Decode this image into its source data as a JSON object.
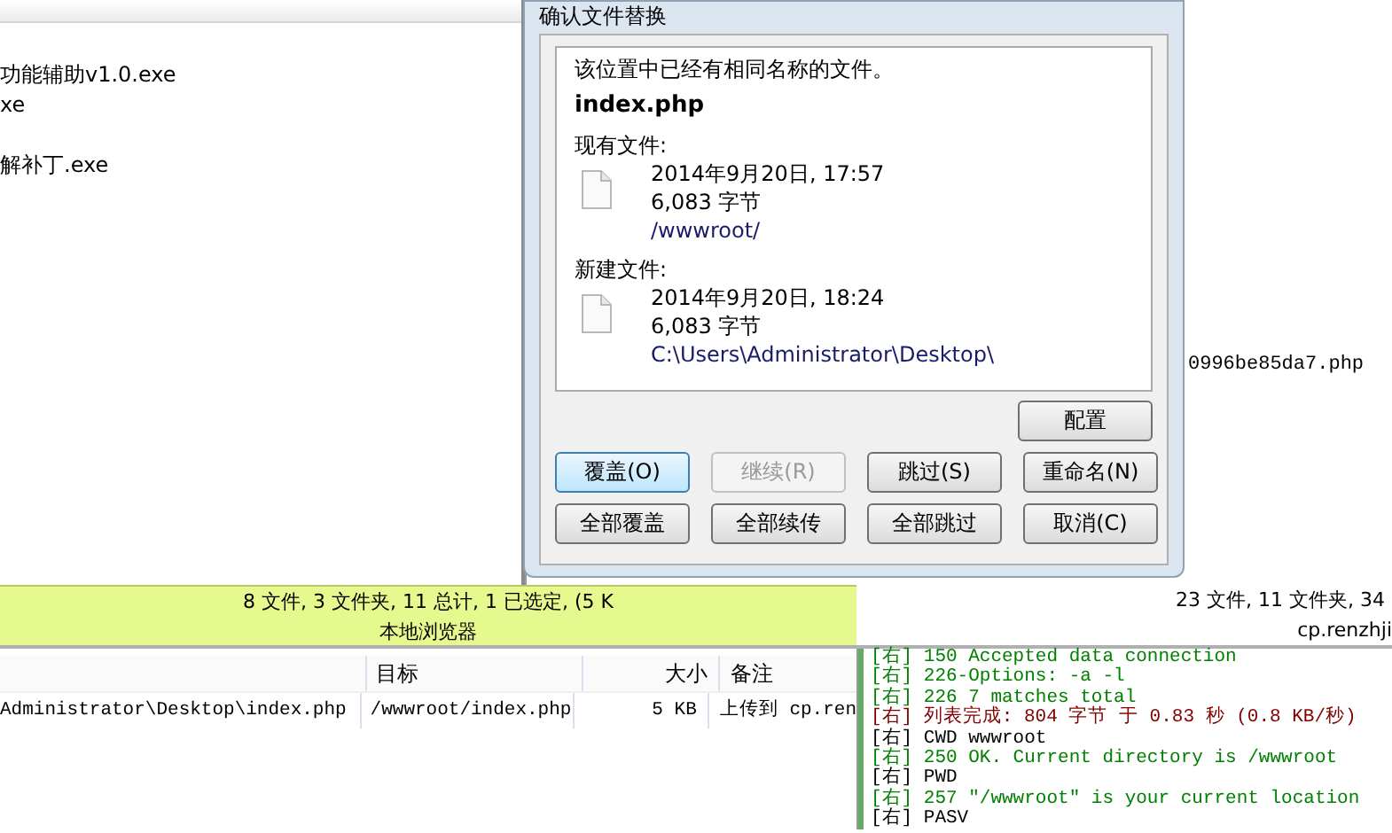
{
  "local_pane": {
    "files": [
      "功能辅助v1.0.exe",
      "xe",
      "解补丁.exe"
    ]
  },
  "remote_pane": {
    "files": [
      "0996be85da7.php"
    ]
  },
  "dialog": {
    "title": "确认文件替换",
    "message": "该位置中已经有相同名称的文件。",
    "filename": "index.php",
    "existing": {
      "label": "现有文件:",
      "date": "2014年9月20日, 17:57",
      "size": "6,083 字节",
      "path": "/wwwroot/"
    },
    "new": {
      "label": "新建文件:",
      "date": "2014年9月20日, 18:24",
      "size": "6,083 字节",
      "path": "C:\\Users\\Administrator\\Desktop\\"
    },
    "config_button": "配置",
    "buttons": [
      {
        "label": "覆盖(O)",
        "disabled": false,
        "focused": true
      },
      {
        "label": "继续(R)",
        "disabled": true,
        "focused": false
      },
      {
        "label": "跳过(S)",
        "disabled": false,
        "focused": false
      },
      {
        "label": "重命名(N)",
        "disabled": false,
        "focused": false
      },
      {
        "label": "全部覆盖",
        "disabled": false,
        "focused": false
      },
      {
        "label": "全部续传",
        "disabled": false,
        "focused": false
      },
      {
        "label": "全部跳过",
        "disabled": false,
        "focused": false
      },
      {
        "label": "取消(C)",
        "disabled": false,
        "focused": false
      }
    ]
  },
  "local_status": {
    "summary": "8 文件, 3 文件夹, 11 总计, 1 已选定, (5 K",
    "title": "本地浏览器"
  },
  "remote_status": {
    "summary": "23 文件, 11 文件夹, 34",
    "title": "cp.renzhji"
  },
  "queue": {
    "columns": [
      "目标",
      "大小",
      "备注"
    ],
    "rows": [
      {
        "source": "Administrator\\Desktop\\index.php",
        "target": "/wwwroot/index.php",
        "size": "5 KB",
        "note": "上传到 cp.ren"
      }
    ]
  },
  "log": [
    {
      "text": "[右] 150 Accepted data connection",
      "color": "#008000"
    },
    {
      "text": "[右] 226-Options: -a -l",
      "color": "#008000"
    },
    {
      "text": "[右] 226 7 matches total",
      "color": "#008000"
    },
    {
      "text": "[右] 列表完成: 804 字节 于 0.83 秒 (0.8 KB/秒)",
      "color": "#800000"
    },
    {
      "text": "[右] CWD wwwroot",
      "color": "#000000"
    },
    {
      "text": "[右] 250 OK. Current directory is /wwwroot",
      "color": "#008000"
    },
    {
      "text": "[右] PWD",
      "color": "#000000"
    },
    {
      "text": "[右] 257 \"/wwwroot\" is your current location",
      "color": "#008000"
    },
    {
      "text": "[右] PASV",
      "color": "#000000"
    }
  ]
}
